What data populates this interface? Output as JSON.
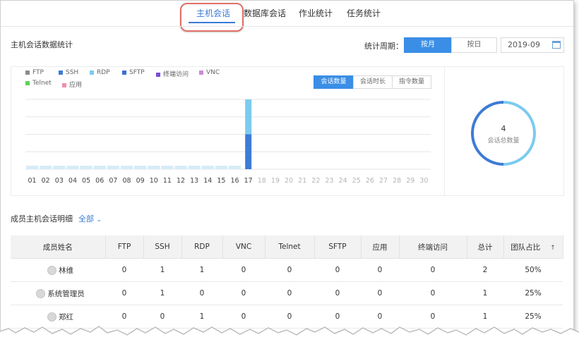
{
  "tabs": [
    "主机会话",
    "数据库会话",
    "作业统计",
    "任务统计"
  ],
  "host_stats": {
    "title": "主机会话数据统计",
    "period_label": "统计周期：",
    "period_options": [
      "按月",
      "按日"
    ],
    "date_value": "2019-09"
  },
  "chart": {
    "legend": [
      {
        "name": "FTP",
        "color": "#8c8c8c"
      },
      {
        "name": "SSH",
        "color": "#3d7bd6"
      },
      {
        "name": "RDP",
        "color": "#7ccbee"
      },
      {
        "name": "SFTP",
        "color": "#3a6fd0"
      },
      {
        "name": "终端访问",
        "color": "#7a4fd6"
      },
      {
        "name": "VNC",
        "color": "#c98bd9"
      },
      {
        "name": "Telnet",
        "color": "#5ed15a"
      },
      {
        "name": "应用",
        "color": "#f08fa8"
      }
    ],
    "metric_buttons": [
      "会话数量",
      "会话时长",
      "指令数量"
    ],
    "donut_value": "4",
    "donut_label": "会话总数量"
  },
  "chart_data": {
    "type": "bar",
    "stacked": true,
    "categories": [
      "01",
      "02",
      "03",
      "04",
      "05",
      "06",
      "07",
      "08",
      "09",
      "10",
      "11",
      "12",
      "13",
      "14",
      "15",
      "16",
      "17",
      "18",
      "19",
      "20",
      "21",
      "22",
      "23",
      "24",
      "25",
      "26",
      "27",
      "28",
      "29",
      "30"
    ],
    "series": [
      {
        "name": "SSH",
        "color": "#3d7bd6",
        "values": [
          0,
          0,
          0,
          0,
          0,
          0,
          0,
          0,
          0,
          0,
          0,
          0,
          0,
          0,
          0,
          0,
          2,
          0,
          0,
          0,
          0,
          0,
          0,
          0,
          0,
          0,
          0,
          0,
          0,
          0
        ]
      },
      {
        "name": "RDP",
        "color": "#7ccbee",
        "values": [
          0,
          0,
          0,
          0,
          0,
          0,
          0,
          0,
          0,
          0,
          0,
          0,
          0,
          0,
          0,
          0,
          2,
          0,
          0,
          0,
          0,
          0,
          0,
          0,
          0,
          0,
          0,
          0,
          0,
          0
        ]
      }
    ],
    "ylim": [
      0,
      4
    ],
    "grid": true,
    "legend_position": "top-left",
    "title": "",
    "xlabel": "",
    "ylabel": ""
  },
  "members": {
    "title": "成员主机会话明细",
    "filter_label": "全部",
    "columns": [
      "成员姓名",
      "FTP",
      "SSH",
      "RDP",
      "VNC",
      "Telnet",
      "SFTP",
      "应用",
      "终端访问",
      "总计",
      "团队占比"
    ],
    "rows": [
      [
        "林维",
        "0",
        "1",
        "1",
        "0",
        "0",
        "0",
        "0",
        "0",
        "2",
        "50%"
      ],
      [
        "系统管理员",
        "0",
        "1",
        "0",
        "0",
        "0",
        "0",
        "0",
        "0",
        "1",
        "25%"
      ],
      [
        "郑红",
        "0",
        "0",
        "1",
        "0",
        "0",
        "0",
        "0",
        "0",
        "1",
        "25%"
      ]
    ]
  }
}
